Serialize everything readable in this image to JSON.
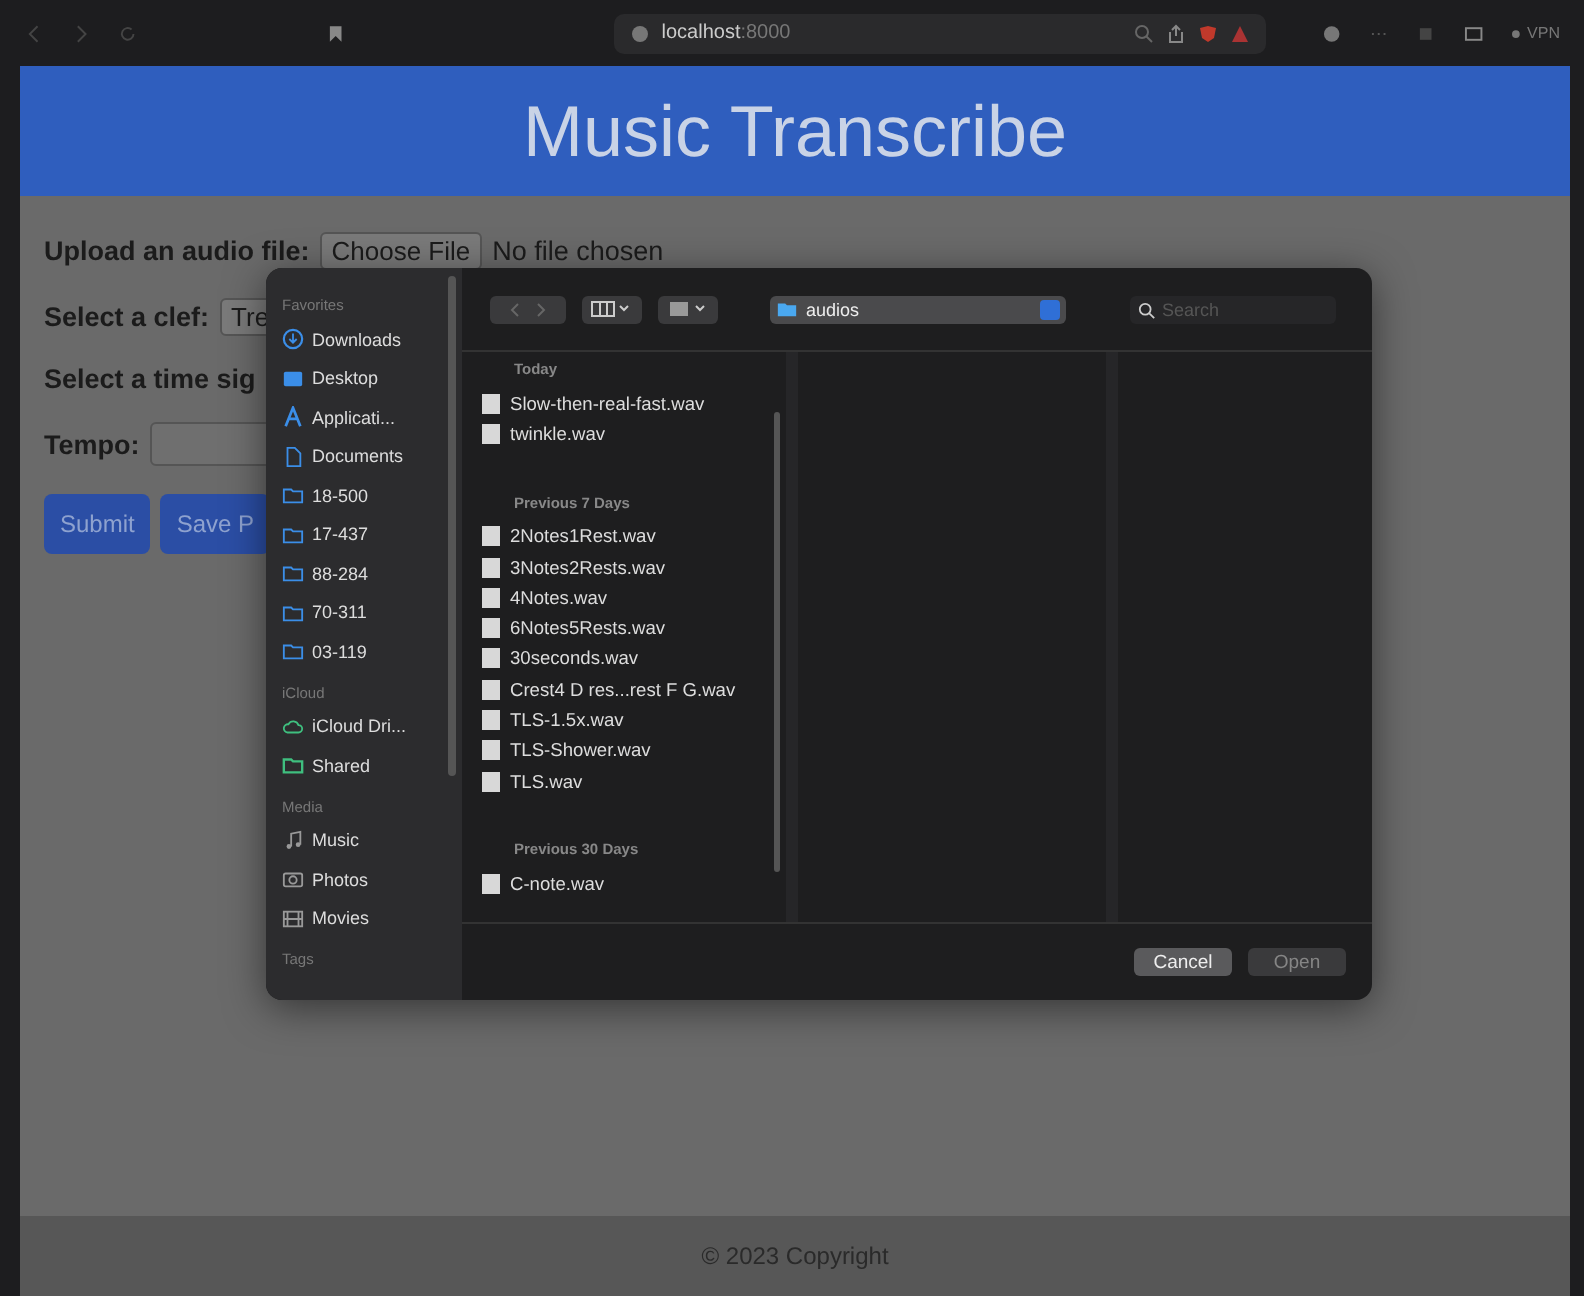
{
  "browser": {
    "address": "localhost",
    "port": ":8000",
    "vpn_label": "VPN"
  },
  "header": {
    "title": "Music Transcribe"
  },
  "form": {
    "upload_label": "Upload an audio file:",
    "choose_button": "Choose File",
    "file_status": "No file chosen",
    "clef_label": "Select a clef:",
    "clef_value": "Tre",
    "time_label": "Select a time sig",
    "tempo_label": "Tempo:",
    "buttons": [
      "Submit",
      "Save P"
    ]
  },
  "dialog": {
    "sidebar": [
      {
        "heading": "Favorites",
        "items": [
          {
            "label": "Downloads",
            "kind": "download"
          },
          {
            "label": "Desktop",
            "kind": "desktop"
          },
          {
            "label": "Applicati...",
            "kind": "apps"
          },
          {
            "label": "Documents",
            "kind": "document"
          },
          {
            "label": "18-500",
            "kind": "folder"
          },
          {
            "label": "17-437",
            "kind": "folder"
          },
          {
            "label": "88-284",
            "kind": "folder"
          },
          {
            "label": "70-311",
            "kind": "folder"
          },
          {
            "label": "03-119",
            "kind": "folder"
          }
        ]
      },
      {
        "heading": "iCloud",
        "items": [
          {
            "label": "iCloud Dri...",
            "kind": "cloud"
          },
          {
            "label": "Shared",
            "kind": "shared"
          }
        ]
      },
      {
        "heading": "Media",
        "items": [
          {
            "label": "Music",
            "kind": "music"
          },
          {
            "label": "Photos",
            "kind": "photo"
          },
          {
            "label": "Movies",
            "kind": "movie"
          }
        ]
      },
      {
        "heading": "Tags"
      }
    ],
    "location": "audios",
    "search_placeholder": "Search",
    "groups": [
      {
        "heading": "Today",
        "files": [
          "Slow-then-real-fast.wav",
          "twinkle.wav"
        ]
      },
      {
        "heading": "Previous 7 Days",
        "files": [
          "2Notes1Rest.wav",
          "3Notes2Rests.wav",
          "4Notes.wav",
          "6Notes5Rests.wav",
          "30seconds.wav",
          "Crest4 D res...rest F G.wav",
          "TLS-1.5x.wav",
          "TLS-Shower.wav",
          "TLS.wav"
        ]
      },
      {
        "heading": "Previous 30 Days",
        "files": [
          "C-note.wav"
        ]
      }
    ],
    "buttons": [
      {
        "label": "Cancel",
        "disabled": false
      },
      {
        "label": "Open",
        "disabled": true
      }
    ]
  },
  "footer": {
    "text": "© 2023 Copyright"
  }
}
